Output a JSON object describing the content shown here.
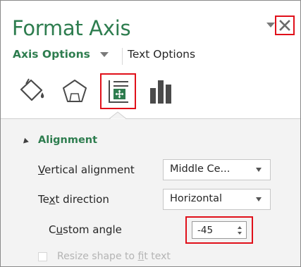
{
  "panel": {
    "title": "Format Axis",
    "tabs": {
      "axis_options": "Axis Options",
      "text_options": "Text Options"
    },
    "icons": [
      "paint-bucket-icon",
      "pentagon-icon",
      "size-properties-icon",
      "bar-chart-icon"
    ],
    "section": {
      "title": "Alignment",
      "vertical_alignment": {
        "label_prefix": "",
        "label_mnemonic": "V",
        "label_rest": "ertical alignment",
        "value": "Middle Ce..."
      },
      "text_direction": {
        "label_prefix": "Te",
        "label_mnemonic": "x",
        "label_rest": "t direction",
        "value": "Horizontal"
      },
      "custom_angle": {
        "label_prefix": "C",
        "label_mnemonic": "u",
        "label_rest": "stom angle",
        "value": "-45"
      },
      "resize_shape": {
        "label_prefix": "Resize shape to ",
        "label_mnemonic": "f",
        "label_rest": "it text",
        "checked": false,
        "disabled": true
      }
    }
  },
  "colors": {
    "accent_green": "#2e7d4f",
    "highlight_red": "#e0101a",
    "section_bg": "#f3f3f3"
  }
}
